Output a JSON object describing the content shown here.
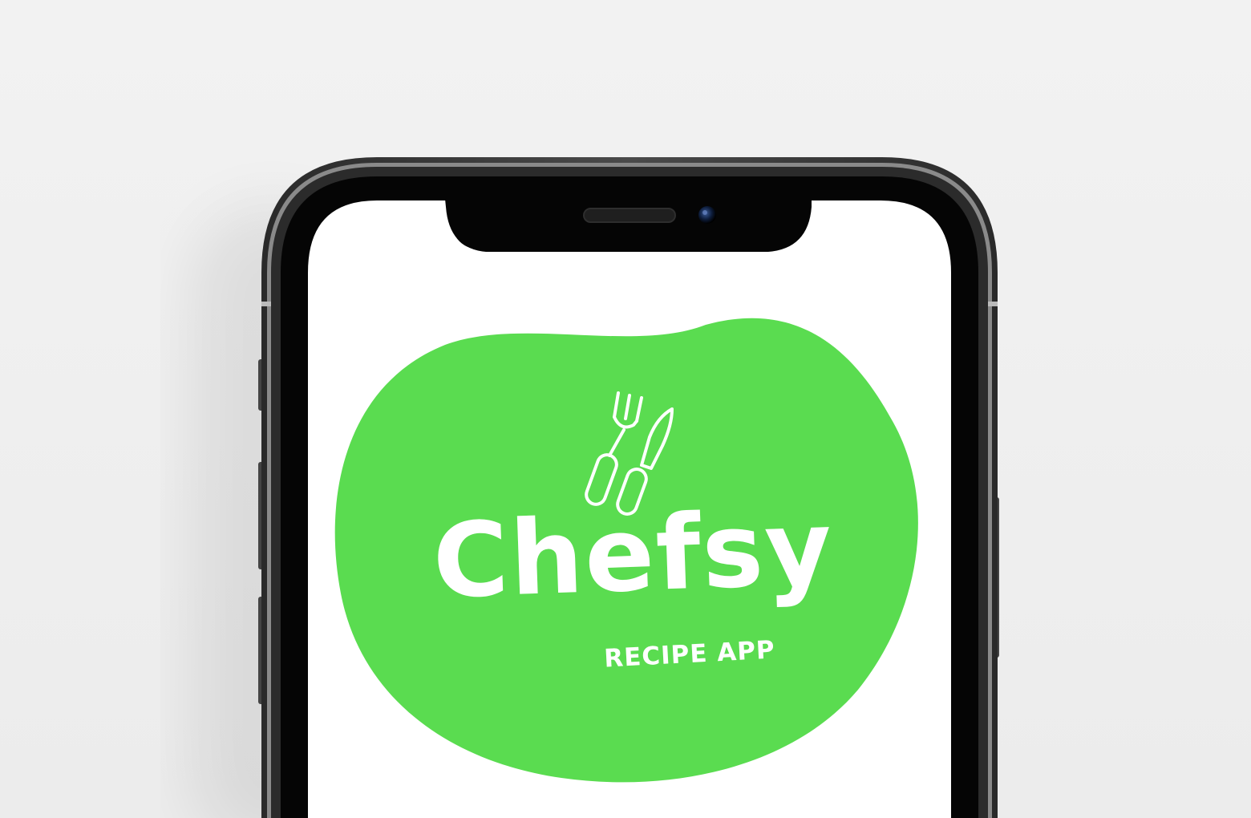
{
  "app": {
    "name": "Chefsy",
    "tagline": "RECIPE APP"
  },
  "icons": {
    "logo": "fork-and-knife-icon",
    "camera": "front-camera-icon",
    "speaker": "earpiece-speaker-icon"
  },
  "colors": {
    "brand_green": "#5ADC50",
    "screen_background": "#ffffff",
    "logo_foreground": "#ffffff",
    "phone_frame": "#1b1b1b",
    "page_background": "#f0f0f0"
  }
}
